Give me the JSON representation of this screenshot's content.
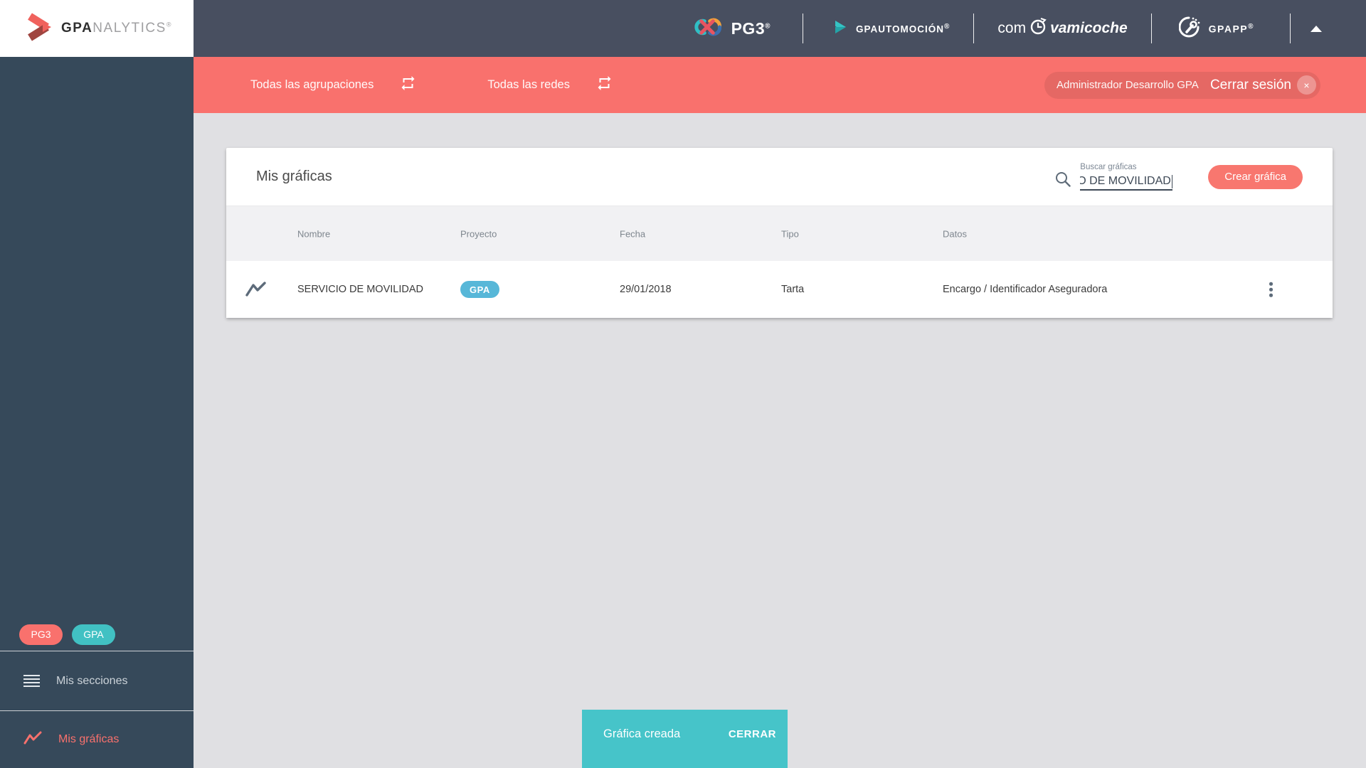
{
  "app": {
    "name_bold": "GPA",
    "name_light": "NALYTICS",
    "reg": "®"
  },
  "topbar": {
    "pg3": {
      "label": "PG3",
      "reg": "®"
    },
    "gpautomocion": {
      "label": "GPAUTOMOCIÓN",
      "reg": "®"
    },
    "comprovamicoche": {
      "prefix": "com",
      "suffix": "vamicoche"
    },
    "gpapp": {
      "label": "GPAPP",
      "reg": "®"
    }
  },
  "filterbar": {
    "agrupaciones": "Todas las agrupaciones",
    "redes": "Todas las redes",
    "usuario": "Administrador Desarrollo GPA",
    "cerrar_sesion": "Cerrar sesión",
    "logout_x": "×"
  },
  "card": {
    "title": "Mis gráficas",
    "search_label": "Buscar gráficas",
    "search_value": "O DE MOVILIDAD",
    "create_button": "Crear gráfica"
  },
  "table": {
    "headers": [
      "Nombre",
      "Proyecto",
      "Fecha",
      "Tipo",
      "Datos"
    ],
    "rows": [
      {
        "nombre": "SERVICIO DE MOVILIDAD",
        "proyecto_badge": "GPA",
        "fecha": "29/01/2018",
        "tipo": "Tarta",
        "datos": "Encargo / Identificador Aseguradora"
      }
    ]
  },
  "sidebar": {
    "badges": [
      {
        "label": "PG3"
      },
      {
        "label": "GPA"
      }
    ],
    "items": [
      {
        "label": "Mis secciones"
      },
      {
        "label": "Mis gráficas"
      }
    ]
  },
  "snackbar": {
    "message": "Gráfica creada",
    "action": "CERRAR"
  },
  "colors": {
    "accent_red": "#f9716d",
    "teal": "#41c1c3",
    "badge_blue": "#57b7d8",
    "snackbar_teal": "#46c4c9",
    "topbar": "#484f60",
    "sidebar": "#36495a",
    "main_bg": "#e0e0e3"
  }
}
